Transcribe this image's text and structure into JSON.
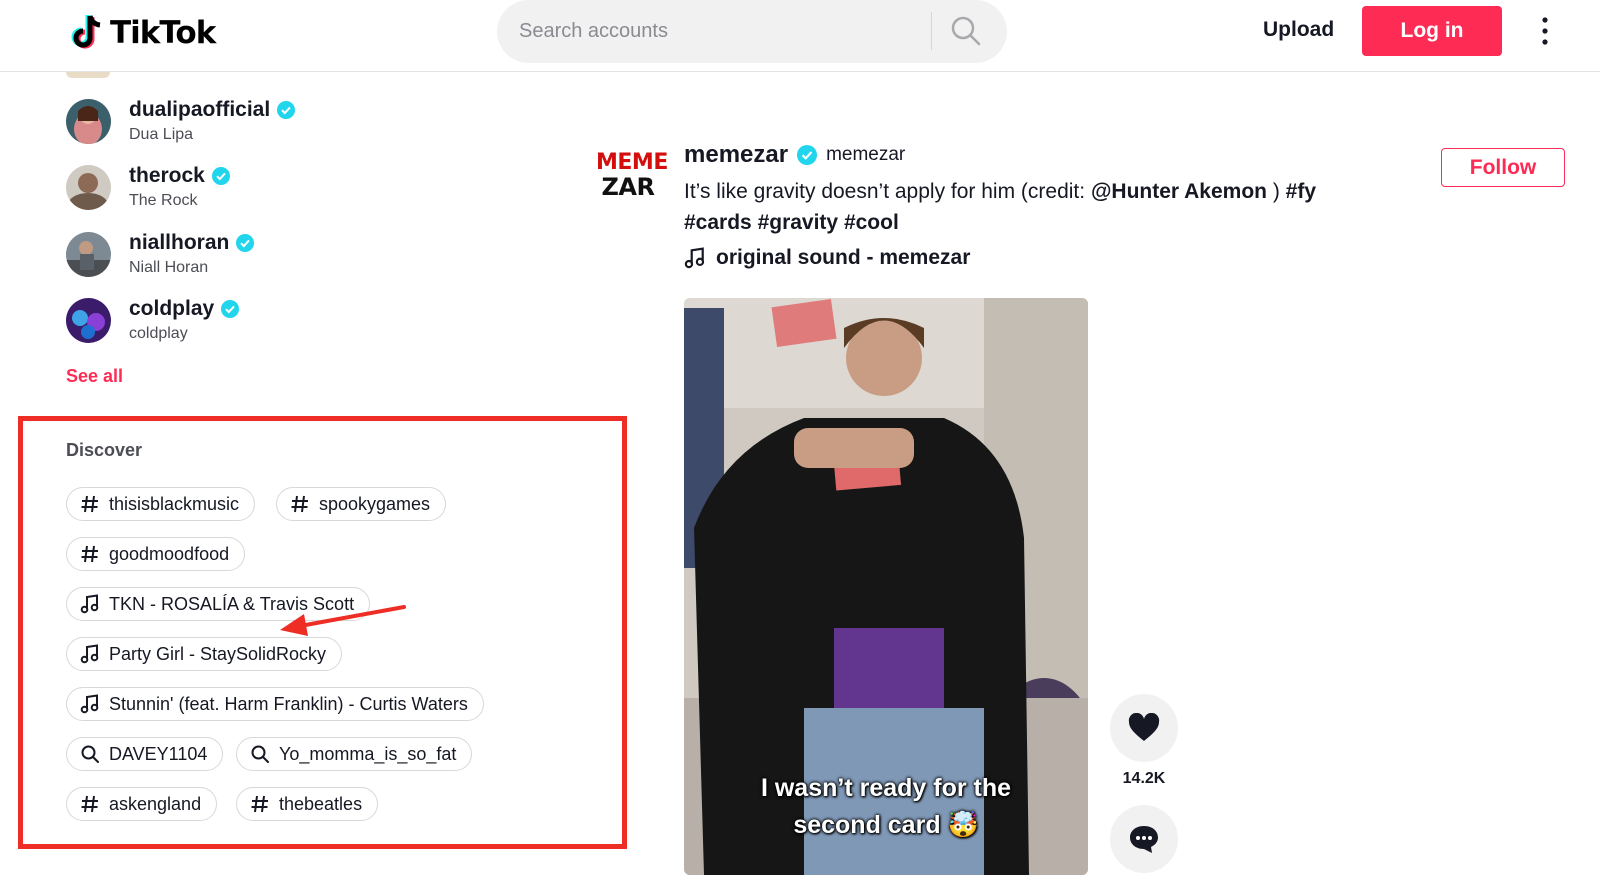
{
  "header": {
    "logo_text": "TikTok",
    "search_placeholder": "Search accounts",
    "upload_label": "Upload",
    "login_label": "Log in"
  },
  "sidebar": {
    "accounts": [
      {
        "username": "dualipaofficial",
        "display_name": "Dua Lipa",
        "verified": true
      },
      {
        "username": "therock",
        "display_name": "The Rock",
        "verified": true
      },
      {
        "username": "niallhoran",
        "display_name": "Niall Horan",
        "verified": true
      },
      {
        "username": "coldplay",
        "display_name": "coldplay",
        "verified": true
      }
    ],
    "see_all_label": "See all",
    "discover": {
      "title": "Discover",
      "items": [
        {
          "type": "hashtag",
          "label": "thisisblackmusic"
        },
        {
          "type": "hashtag",
          "label": "spookygames"
        },
        {
          "type": "hashtag",
          "label": "goodmoodfood"
        },
        {
          "type": "music",
          "label": "TKN - ROSALÍA & Travis Scott"
        },
        {
          "type": "music",
          "label": "Party Girl - StaySolidRocky"
        },
        {
          "type": "music",
          "label": "Stunnin' (feat. Harm Franklin) - Curtis Waters"
        },
        {
          "type": "search",
          "label": "DAVEY1104"
        },
        {
          "type": "search",
          "label": "Yo_momma_is_so_fat"
        },
        {
          "type": "hashtag",
          "label": "askengland"
        },
        {
          "type": "hashtag",
          "label": "thebeatles"
        }
      ]
    }
  },
  "post": {
    "author_avatar_line1": "MEME",
    "author_avatar_line2": "ZAR",
    "author_username": "memezar",
    "author_nickname": "memezar",
    "verified": true,
    "caption_text": "It’s like gravity doesn’t apply for him (credit: ",
    "caption_mention": "@Hunter Akemon",
    "caption_after_mention": " ) ",
    "caption_tags": [
      "#fy",
      "#cards",
      "#gravity",
      "#cool"
    ],
    "sound": "original sound - memezar",
    "follow_label": "Follow",
    "video_caption_line1": "I wasn’t ready for the",
    "video_caption_line2": "second card 🤯",
    "like_count": "14.2K"
  },
  "colors": {
    "brand": "#fe2c55",
    "verified": "#20d5ec",
    "annotation": "#ee2d24"
  },
  "icons": [
    "tiktok-logo-icon",
    "search-icon",
    "more-vertical-icon",
    "verified-badge-icon",
    "hashtag-icon",
    "music-note-icon",
    "heart-icon",
    "comment-icon"
  ]
}
